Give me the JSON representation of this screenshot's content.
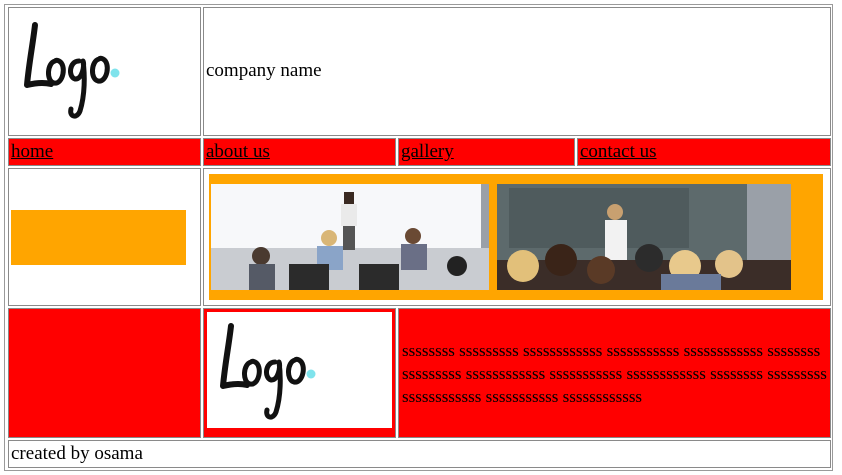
{
  "header": {
    "logo_text": "Logo",
    "company_name": "company name"
  },
  "nav": [
    {
      "label": "home"
    },
    {
      "label": "about us"
    },
    {
      "label": "gallery"
    },
    {
      "label": "contact us"
    }
  ],
  "content": {
    "paragraph": "ssssssss sssssssss ssssssssssss sssssssssss ssssssssssss ssssssss sssssssss ssssssssssss sssssssssss ssssssssssss ssssssss sssssssss ssssssssssss sssssssssss ssssssssssss"
  },
  "footer": {
    "credit": "created by osama"
  },
  "colors": {
    "accent_red": "#ff0000",
    "accent_orange": "#ffa500",
    "logo_dot": "#7fe3ec"
  }
}
